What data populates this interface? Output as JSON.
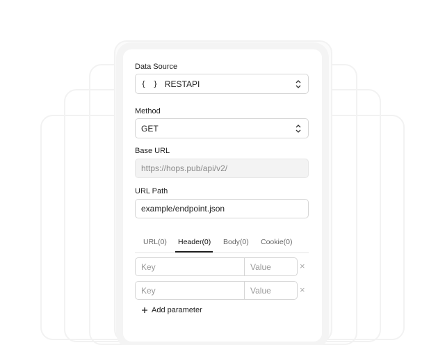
{
  "form": {
    "data_source": {
      "label": "Data Source",
      "icon": "braces-icon",
      "icon_text": "{ }",
      "value": "RESTAPI"
    },
    "method": {
      "label": "Method",
      "value": "GET"
    },
    "base_url": {
      "label": "Base URL",
      "value": "https://hops.pub/api/v2/"
    },
    "url_path": {
      "label": "URL Path",
      "value": "example/endpoint.json"
    }
  },
  "tabs": [
    {
      "label": "URL(0)",
      "active": false
    },
    {
      "label": "Header(0)",
      "active": true
    },
    {
      "label": "Body(0)",
      "active": false
    },
    {
      "label": "Cookie(0)",
      "active": false
    }
  ],
  "params": [
    {
      "key_placeholder": "Key",
      "value_placeholder": "Value",
      "remove": "×"
    },
    {
      "key_placeholder": "Key",
      "value_placeholder": "Value",
      "remove": "×"
    }
  ],
  "add_parameter": {
    "icon": "plus-icon",
    "label": "Add parameter"
  }
}
